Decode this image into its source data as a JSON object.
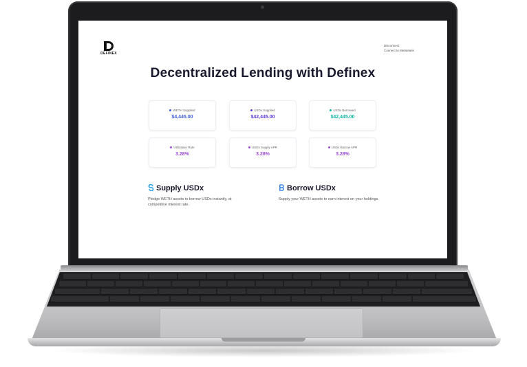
{
  "app": {
    "logo_text": "DEFINEX",
    "disconnect_label": "Disconnect",
    "connect_label": "Connect to MetaMask",
    "title": "Decentralized Lending with Definex"
  },
  "stats": [
    {
      "label": "WETH Supplied",
      "value": "$4,445.00",
      "color": "#3b5bdb",
      "icon": "dot-icon"
    },
    {
      "label": "USDx Supplied",
      "value": "$42,445.00",
      "color": "#5b3bdb",
      "icon": "dot-icon"
    },
    {
      "label": "USDx Borrowed",
      "value": "$42,445.00",
      "color": "#12b5a5",
      "icon": "dot-icon"
    },
    {
      "label": "Utilization Rate",
      "value": "3.28%",
      "color": "#9b4bd8",
      "icon": "dot-icon"
    },
    {
      "label": "USDx Supply APR",
      "value": "3.28%",
      "color": "#9b4bd8",
      "icon": "dot-icon"
    },
    {
      "label": "USDx Borrow APR",
      "value": "3.28%",
      "color": "#9b4bd8",
      "icon": "dot-icon"
    }
  ],
  "sections": {
    "supply": {
      "title": "Supply USDx",
      "description": "Pledge WETH assets to borrow USDx instantly, at competitive interest rate.",
      "icon": "supply-icon",
      "color": "#2fa3e6"
    },
    "borrow": {
      "title": "Borrow USDx",
      "description": "Supply your WETH assets to earn interest on your holdings.",
      "icon": "borrow-icon",
      "color": "#2f7fe6"
    }
  }
}
